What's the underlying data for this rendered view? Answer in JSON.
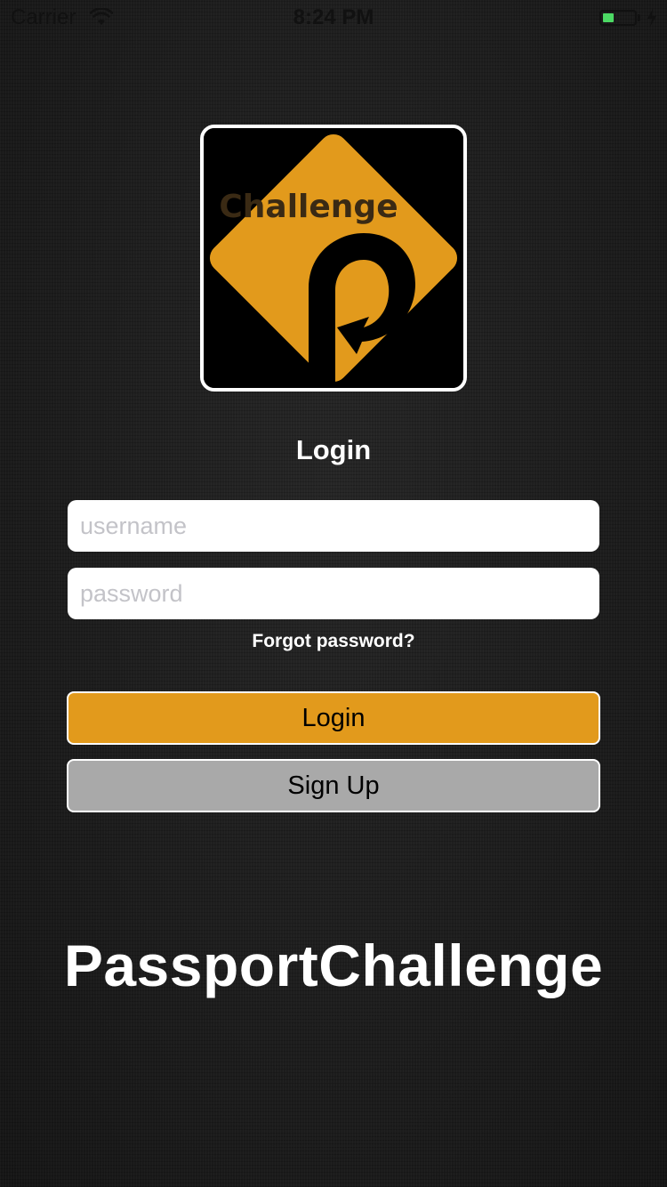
{
  "status_bar": {
    "carrier": "Carrier",
    "time": "8:24 PM",
    "battery_level": 0.35,
    "icons": [
      "wifi-icon",
      "battery-icon",
      "charging-bolt-icon"
    ]
  },
  "logo": {
    "text": "Challenge",
    "mark": "p-arrow-road-sign",
    "accent_color": "#e29a1c"
  },
  "login": {
    "heading": "Login",
    "username_placeholder": "username",
    "password_placeholder": "password",
    "forgot_password": "Forgot password?",
    "login_button": "Login",
    "signup_button": "Sign Up"
  },
  "footer": {
    "app_name": "PassportChallenge"
  },
  "colors": {
    "login_button": "#e29a1c",
    "signup_button": "#a9a9a9",
    "background": "#1c1c1c"
  }
}
